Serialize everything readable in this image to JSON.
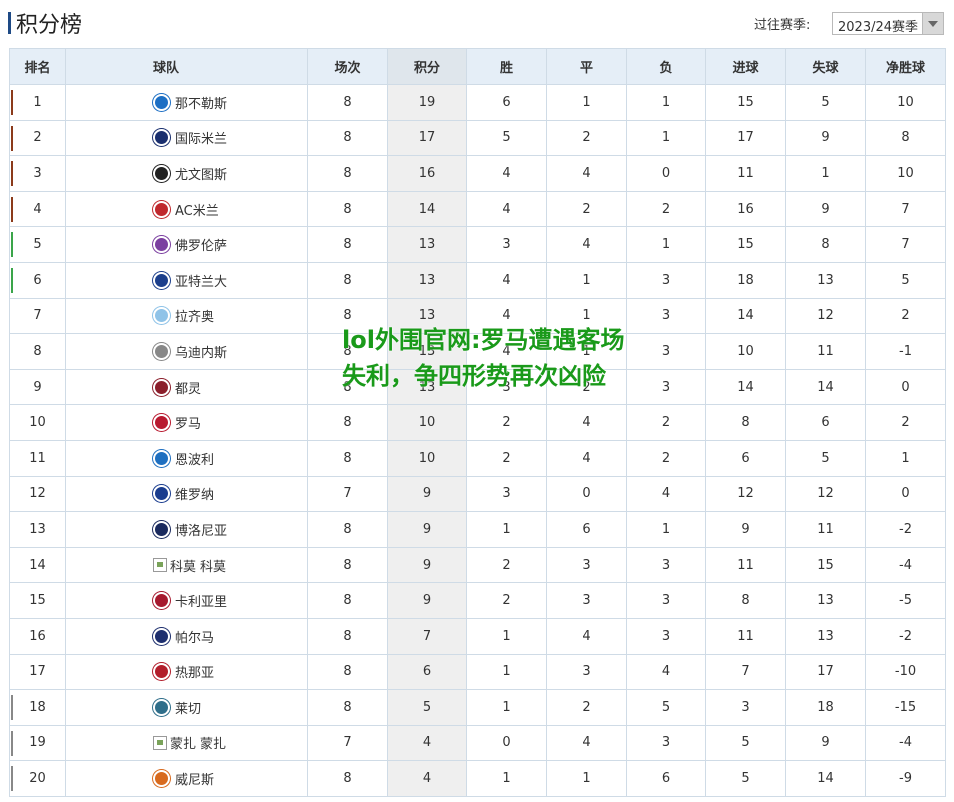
{
  "header": {
    "title": "积分榜",
    "season_label": "过往赛季:",
    "season_value": "2023/24赛季"
  },
  "table": {
    "columns": [
      "排名",
      "球队",
      "场次",
      "积分",
      "胜",
      "平",
      "负",
      "进球",
      "失球",
      "净胜球"
    ],
    "rows": [
      {
        "rank": "1",
        "team": "那不勒斯",
        "played": "8",
        "pts": "19",
        "w": "6",
        "d": "1",
        "l": "1",
        "gf": "15",
        "ga": "5",
        "gd": "10",
        "badge": "#1d6fc4",
        "mark": "#8b3a1a"
      },
      {
        "rank": "2",
        "team": "国际米兰",
        "played": "8",
        "pts": "17",
        "w": "5",
        "d": "2",
        "l": "1",
        "gf": "17",
        "ga": "9",
        "gd": "8",
        "badge": "#1a2f6e",
        "mark": "#8b3a1a"
      },
      {
        "rank": "3",
        "team": "尤文图斯",
        "played": "8",
        "pts": "16",
        "w": "4",
        "d": "4",
        "l": "0",
        "gf": "11",
        "ga": "1",
        "gd": "10",
        "badge": "#222222",
        "mark": "#8b3a1a"
      },
      {
        "rank": "4",
        "team": "AC米兰",
        "played": "8",
        "pts": "14",
        "w": "4",
        "d": "2",
        "l": "2",
        "gf": "16",
        "ga": "9",
        "gd": "7",
        "badge": "#c0282d",
        "mark": "#8b3a1a"
      },
      {
        "rank": "5",
        "team": "佛罗伦萨",
        "played": "8",
        "pts": "13",
        "w": "3",
        "d": "4",
        "l": "1",
        "gf": "15",
        "ga": "8",
        "gd": "7",
        "badge": "#7b3fa0",
        "mark": "#3aa54a"
      },
      {
        "rank": "6",
        "team": "亚特兰大",
        "played": "8",
        "pts": "13",
        "w": "4",
        "d": "1",
        "l": "3",
        "gf": "18",
        "ga": "13",
        "gd": "5",
        "badge": "#1c3f8c",
        "mark": "#3aa54a"
      },
      {
        "rank": "7",
        "team": "拉齐奥",
        "played": "8",
        "pts": "13",
        "w": "4",
        "d": "1",
        "l": "3",
        "gf": "14",
        "ga": "12",
        "gd": "2",
        "badge": "#8fc3e8",
        "mark": ""
      },
      {
        "rank": "8",
        "team": "乌迪内斯",
        "played": "8",
        "pts": "13",
        "w": "4",
        "d": "1",
        "l": "3",
        "gf": "10",
        "ga": "11",
        "gd": "-1",
        "badge": "#888888",
        "mark": ""
      },
      {
        "rank": "9",
        "team": "都灵",
        "played": "8",
        "pts": "13",
        "w": "3",
        "d": "2",
        "l": "3",
        "gf": "14",
        "ga": "14",
        "gd": "0",
        "badge": "#8b1e2b",
        "mark": ""
      },
      {
        "rank": "10",
        "team": "罗马",
        "played": "8",
        "pts": "10",
        "w": "2",
        "d": "4",
        "l": "2",
        "gf": "8",
        "ga": "6",
        "gd": "2",
        "badge": "#b8192f",
        "mark": ""
      },
      {
        "rank": "11",
        "team": "恩波利",
        "played": "8",
        "pts": "10",
        "w": "2",
        "d": "4",
        "l": "2",
        "gf": "6",
        "ga": "5",
        "gd": "1",
        "badge": "#1e6fc0",
        "mark": ""
      },
      {
        "rank": "12",
        "team": "维罗纳",
        "played": "7",
        "pts": "9",
        "w": "3",
        "d": "0",
        "l": "4",
        "gf": "12",
        "ga": "12",
        "gd": "0",
        "badge": "#1a3d8f",
        "mark": ""
      },
      {
        "rank": "13",
        "team": "博洛尼亚",
        "played": "8",
        "pts": "9",
        "w": "1",
        "d": "6",
        "l": "1",
        "gf": "9",
        "ga": "11",
        "gd": "-2",
        "badge": "#1a2a5e",
        "mark": ""
      },
      {
        "rank": "14",
        "team": "科莫",
        "img_alt": "科莫",
        "played": "8",
        "pts": "9",
        "w": "2",
        "d": "3",
        "l": "3",
        "gf": "11",
        "ga": "15",
        "gd": "-4",
        "badge": "",
        "mark": ""
      },
      {
        "rank": "15",
        "team": "卡利亚里",
        "played": "8",
        "pts": "9",
        "w": "2",
        "d": "3",
        "l": "3",
        "gf": "8",
        "ga": "13",
        "gd": "-5",
        "badge": "#a6192e",
        "mark": ""
      },
      {
        "rank": "16",
        "team": "帕尔马",
        "played": "8",
        "pts": "7",
        "w": "1",
        "d": "4",
        "l": "3",
        "gf": "11",
        "ga": "13",
        "gd": "-2",
        "badge": "#1e2f6e",
        "mark": ""
      },
      {
        "rank": "17",
        "team": "热那亚",
        "played": "8",
        "pts": "6",
        "w": "1",
        "d": "3",
        "l": "4",
        "gf": "7",
        "ga": "17",
        "gd": "-10",
        "badge": "#b21e2b",
        "mark": ""
      },
      {
        "rank": "18",
        "team": "莱切",
        "played": "8",
        "pts": "5",
        "w": "1",
        "d": "2",
        "l": "5",
        "gf": "3",
        "ga": "18",
        "gd": "-15",
        "badge": "#2f6e8a",
        "mark": "#888888"
      },
      {
        "rank": "19",
        "team": "蒙扎",
        "img_alt": "蒙扎",
        "played": "7",
        "pts": "4",
        "w": "0",
        "d": "4",
        "l": "3",
        "gf": "5",
        "ga": "9",
        "gd": "-4",
        "badge": "",
        "mark": "#888888"
      },
      {
        "rank": "20",
        "team": "威尼斯",
        "played": "8",
        "pts": "4",
        "w": "1",
        "d": "1",
        "l": "6",
        "gf": "5",
        "ga": "14",
        "gd": "-9",
        "badge": "#d86a1e",
        "mark": "#888888"
      }
    ]
  },
  "watermark": {
    "text": "lol外围官网:罗马遭遇客场失利，争四形势再次凶险"
  }
}
